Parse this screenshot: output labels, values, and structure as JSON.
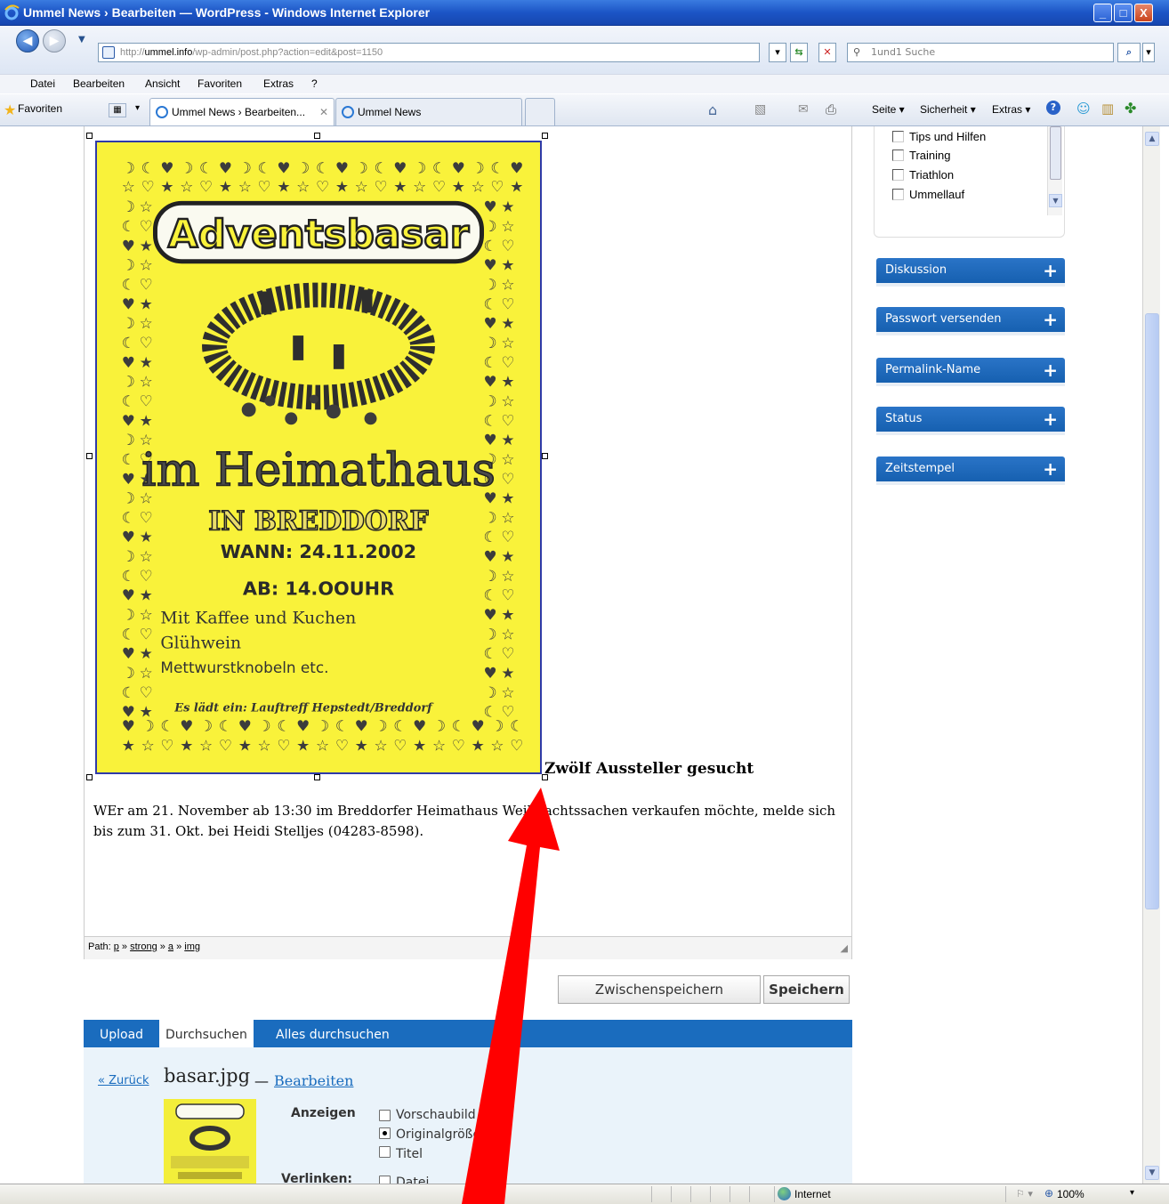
{
  "window": {
    "title": "Ummel News › Bearbeiten — WordPress - Windows Internet Explorer",
    "min": "_",
    "max": "□",
    "close": "X"
  },
  "address": {
    "url_prefix": "http://",
    "url_domain": "ummel.info",
    "url_rest": "/wp-admin/post.php?action=edit&post=1150",
    "search_placeholder": "1und1 Suche"
  },
  "menu": [
    "Datei",
    "Bearbeiten",
    "Ansicht",
    "Favoriten",
    "Extras",
    "?"
  ],
  "favbar": {
    "favorites": "Favoriten",
    "tabs": [
      {
        "label": "Ummel News › Bearbeiten...",
        "active": true
      },
      {
        "label": "Ummel News",
        "active": false
      }
    ],
    "commands": [
      "Seite ▾",
      "Sicherheit ▾",
      "Extras ▾"
    ]
  },
  "categories": [
    "Tips und Hilfen",
    "Training",
    "Triathlon",
    "Ummellauf"
  ],
  "sidebar_boxes": [
    "Diskussion",
    "Passwort versenden",
    "Permalink-Name",
    "Status",
    "Zeitstempel"
  ],
  "poster": {
    "title": "Adventsbasar",
    "location1": "im Heimathaus",
    "location2": "IN BREDDORF",
    "when": "WANN: 24.11.2002",
    "from": "AB: 14.OOUHR",
    "line1": "Mit Kaffee und Kuchen",
    "line2": "Glühwein",
    "line3": "Mettwurstknobeln etc.",
    "invite": "Es lädt ein: Lauftreff Hepstedt/Breddorf"
  },
  "editor": {
    "heading": "Zwölf Aussteller gesucht",
    "paragraph": "WEr am 21. November ab 13:30 im Breddorfer Heimathaus Weihnachtssachen verkaufen möchte, melde sich bis zum 31. Okt. bei Heidi Stelljes (04283-8598).",
    "path_label": "Path:",
    "path": [
      "p",
      "strong",
      "a",
      "img"
    ]
  },
  "buttons": {
    "save_draft": "Zwischenspeichern",
    "save": "Speichern"
  },
  "upload": {
    "tabs": [
      "Upload",
      "Durchsuchen",
      "Alles durchsuchen"
    ],
    "active_tab": "Durchsuchen",
    "back": "« Zurück",
    "filename": "basar.jpg",
    "dash": "—",
    "edit": "Bearbeiten",
    "show_label": "Anzeigen",
    "show_options": [
      "Vorschaubild",
      "Originalgröße",
      "Titel"
    ],
    "show_selected": "Originalgröße",
    "link_label": "Verlinken:",
    "link_options": [
      "Datei"
    ]
  },
  "status": {
    "zone": "Internet",
    "zoom": "100%"
  },
  "colors": {
    "wp_blue": "#1a6cbe",
    "poster_yellow": "#f9f23a",
    "arrow_red": "#ff0000"
  }
}
